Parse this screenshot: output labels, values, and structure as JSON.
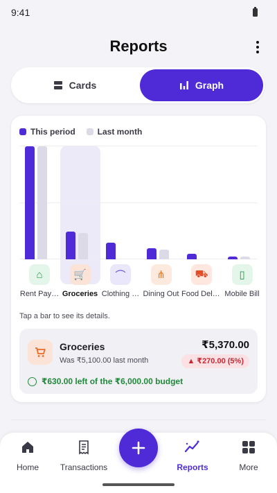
{
  "status_bar": {
    "time": "9:41"
  },
  "header": {
    "title": "Reports"
  },
  "segmented": {
    "cards_label": "Cards",
    "graph_label": "Graph",
    "selected": "graph"
  },
  "colors": {
    "accent": "#4f2bd8",
    "last_month": "#dcdae6",
    "over_budget": "#c62835",
    "within_budget": "#1f8a3a"
  },
  "chart_data": {
    "type": "bar",
    "categories": [
      "Rent Pay…",
      "Groceries",
      "Clothing …",
      "Dining Out",
      "Food Deli…",
      "Mobile Bill"
    ],
    "category_icons": [
      "home-icon",
      "cart-icon",
      "hanger-icon",
      "cutlery-icon",
      "scooter-icon",
      "phone-icon"
    ],
    "category_colors": [
      "#e4f6e9",
      "#fbe3d8",
      "#ebe7fb",
      "#fdeadf",
      "#fde7df",
      "#e4f6e9"
    ],
    "icon_colors": [
      "#1f9a46",
      "#f06a23",
      "#6b4bd8",
      "#e0782a",
      "#e24d2a",
      "#1f9a46"
    ],
    "series": [
      {
        "name": "This period",
        "color": "#4f2bd8",
        "values": [
          22000,
          5370,
          3200,
          2100,
          1100,
          600
        ]
      },
      {
        "name": "Last month",
        "color": "#dcdae6",
        "values": [
          22000,
          5100,
          0,
          1900,
          0,
          600
        ]
      }
    ],
    "ylim": [
      0,
      22000
    ],
    "grid": true,
    "legend": "top-left",
    "selected_index": 1
  },
  "hint": "Tap a bar to see its details.",
  "detail": {
    "name": "Groceries",
    "previous": "Was ₹5,100.00 last month",
    "amount": "₹5,370.00",
    "change": "▲ ₹270.00 (5%)",
    "budget_note": "₹630.00 left of the ₹6,000.00 budget"
  },
  "nav": {
    "items": [
      {
        "label": "Home",
        "icon": "home-icon"
      },
      {
        "label": "Transactions",
        "icon": "receipt-icon"
      },
      {
        "label": "Reports",
        "icon": "trend-icon"
      },
      {
        "label": "More",
        "icon": "grid-icon"
      }
    ],
    "active": "Reports"
  }
}
